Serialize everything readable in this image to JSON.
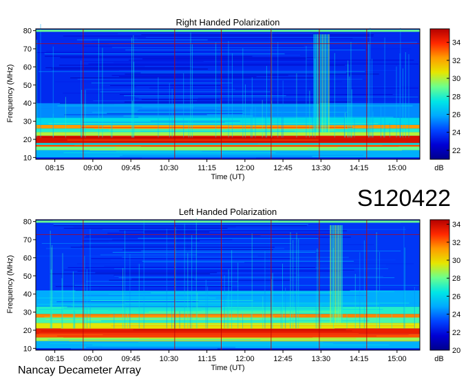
{
  "window": {
    "label": "S120422",
    "footer": "Nancay Decameter Array"
  },
  "colors": {
    "colormap": [
      "#00008c",
      "#0000d4",
      "#0044ff",
      "#00a8ff",
      "#00e6e6",
      "#6cff8c",
      "#e6e600",
      "#ff9c00",
      "#ff2800",
      "#b40000"
    ]
  },
  "chart_data": [
    {
      "type": "heatmap",
      "title": "Right Handed Polarization",
      "xlabel": "Time (UT)",
      "ylabel": "Frequency (MHz)",
      "colorbar_label": "dB",
      "xticks": [
        "08:15",
        "09:00",
        "09:45",
        "10:30",
        "11:15",
        "12:00",
        "12:45",
        "13:30",
        "14:15",
        "15:00"
      ],
      "yticks": [
        10,
        20,
        30,
        40,
        50,
        60,
        70,
        80
      ],
      "ylim": [
        9,
        81
      ],
      "xlim_minutes": [
        470,
        940
      ],
      "colorbar_ticks": [
        22,
        24,
        26,
        28,
        30,
        32,
        34
      ],
      "clim": [
        21,
        35.5
      ],
      "bands": [
        {
          "from": 10,
          "to": 14,
          "level": 0.35
        },
        {
          "from": 14,
          "to": 16,
          "level": 0.55
        },
        {
          "from": 16,
          "to": 17,
          "level": 0.85
        },
        {
          "from": 17,
          "to": 18,
          "level": 0.45
        },
        {
          "from": 18,
          "to": 22,
          "level": 0.95
        },
        {
          "from": 22,
          "to": 24,
          "level": 0.62
        },
        {
          "from": 24,
          "to": 26,
          "level": 0.48
        },
        {
          "from": 26,
          "to": 28,
          "level": 0.78
        },
        {
          "from": 28,
          "to": 32,
          "level": 0.42
        },
        {
          "from": 32,
          "to": 40,
          "level": 0.3
        },
        {
          "from": 40,
          "to": 80,
          "level": 0.18
        }
      ],
      "burst_intervals": [
        [
          810,
          830
        ]
      ],
      "vlines": [
        528,
        640,
        697,
        758,
        817,
        875
      ]
    },
    {
      "type": "heatmap",
      "title": "Left Handed Polarization",
      "xlabel": "Time (UT)",
      "ylabel": "Frequency (MHz)",
      "colorbar_label": "dB",
      "xticks": [
        "08:15",
        "09:00",
        "09:45",
        "10:30",
        "11:15",
        "12:00",
        "12:45",
        "13:30",
        "14:15",
        "15:00"
      ],
      "yticks": [
        10,
        20,
        30,
        40,
        50,
        60,
        70,
        80
      ],
      "ylim": [
        9,
        81
      ],
      "xlim_minutes": [
        470,
        940
      ],
      "colorbar_ticks": [
        20,
        22,
        24,
        26,
        28,
        30,
        32,
        34
      ],
      "clim": [
        20,
        34.5
      ],
      "bands": [
        {
          "from": 10,
          "to": 14,
          "level": 0.35
        },
        {
          "from": 14,
          "to": 16,
          "level": 0.6
        },
        {
          "from": 16,
          "to": 18,
          "level": 0.85
        },
        {
          "from": 18,
          "to": 21,
          "level": 0.92
        },
        {
          "from": 21,
          "to": 24,
          "level": 0.66
        },
        {
          "from": 24,
          "to": 27,
          "level": 0.52
        },
        {
          "from": 27,
          "to": 29,
          "level": 0.8
        },
        {
          "from": 29,
          "to": 33,
          "level": 0.48
        },
        {
          "from": 33,
          "to": 42,
          "level": 0.34
        },
        {
          "from": 42,
          "to": 80,
          "level": 0.2
        }
      ],
      "burst_intervals": [
        [
          830,
          845
        ]
      ],
      "vlines": [
        528,
        640,
        697,
        758,
        817,
        875
      ]
    }
  ]
}
